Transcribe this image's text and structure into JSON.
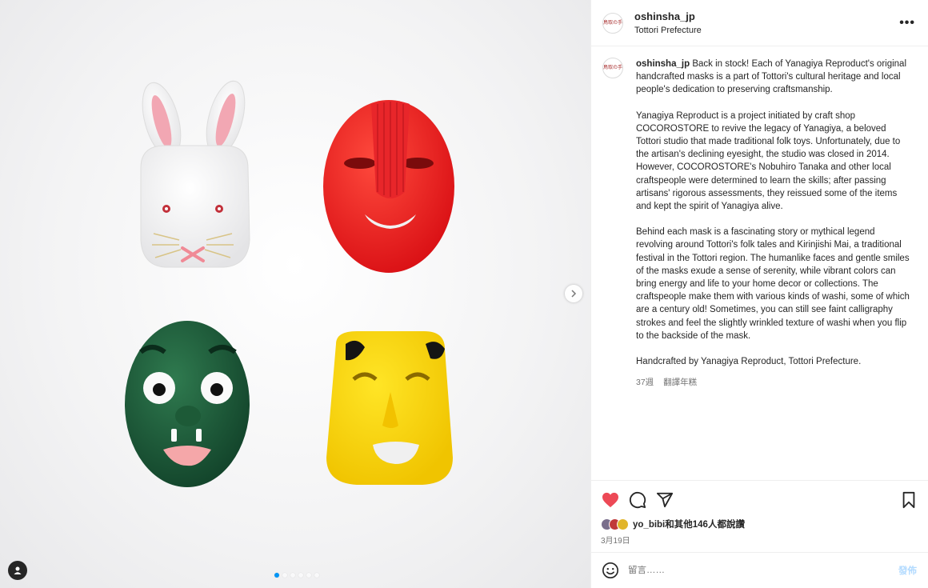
{
  "post": {
    "username": "oshinsha_jp",
    "location": "Tottori Prefecture",
    "avatar_text": "鳥取の手"
  },
  "caption": {
    "username": "oshinsha_jp",
    "paragraphs": [
      "Back in stock! Each of Yanagiya Reproduct's original handcrafted masks is a part of Tottori's cultural heritage and local people's dedication to preserving craftsmanship.",
      "Yanagiya Reproduct is a project initiated by craft shop COCOROSTORE to revive the legacy of Yanagiya, a beloved Tottori studio that made traditional folk toys. Unfortunately, due to the artisan's declining eyesight, the studio was closed in 2014. However, COCOROSTORE's Nobuhiro Tanaka and other local craftspeople were determined to learn the skills; after passing artisans' rigorous assessments, they reissued some of the items and kept the spirit of Yanagiya alive.",
      "Behind each mask is a fascinating story or mythical legend revolving around Tottori's folk tales and Kirinjishi Mai, a traditional festival in the Tottori region. The humanlike faces and gentle smiles of the masks exude a sense of serenity, while vibrant colors can bring energy and life to your home decor or collections. The craftspeople make them with various kinds of washi, some of which are a century old! Sometimes, you can still see faint calligraphy strokes and feel the slightly wrinkled texture of washi when you flip to the backside of the mask.",
      "Handcrafted by Yanagiya Reproduct, Tottori Prefecture."
    ],
    "age": "37週",
    "translate": "翻譯年糕"
  },
  "likes": {
    "text": "yo_bibi和其他146人都說讚",
    "date": "3月19日"
  },
  "comment": {
    "placeholder": "留言……",
    "post_label": "發佈"
  },
  "carousel": {
    "count": 6,
    "active": 0
  },
  "colors": {
    "like_red": "#ed4956",
    "link_blue": "#0095f6",
    "post_disabled": "#b3dbff"
  },
  "icons": [
    "heart-icon",
    "comment-icon",
    "share-icon",
    "bookmark-icon",
    "emoji-icon",
    "more-icon",
    "chevron-right-icon",
    "user-tag-icon"
  ]
}
